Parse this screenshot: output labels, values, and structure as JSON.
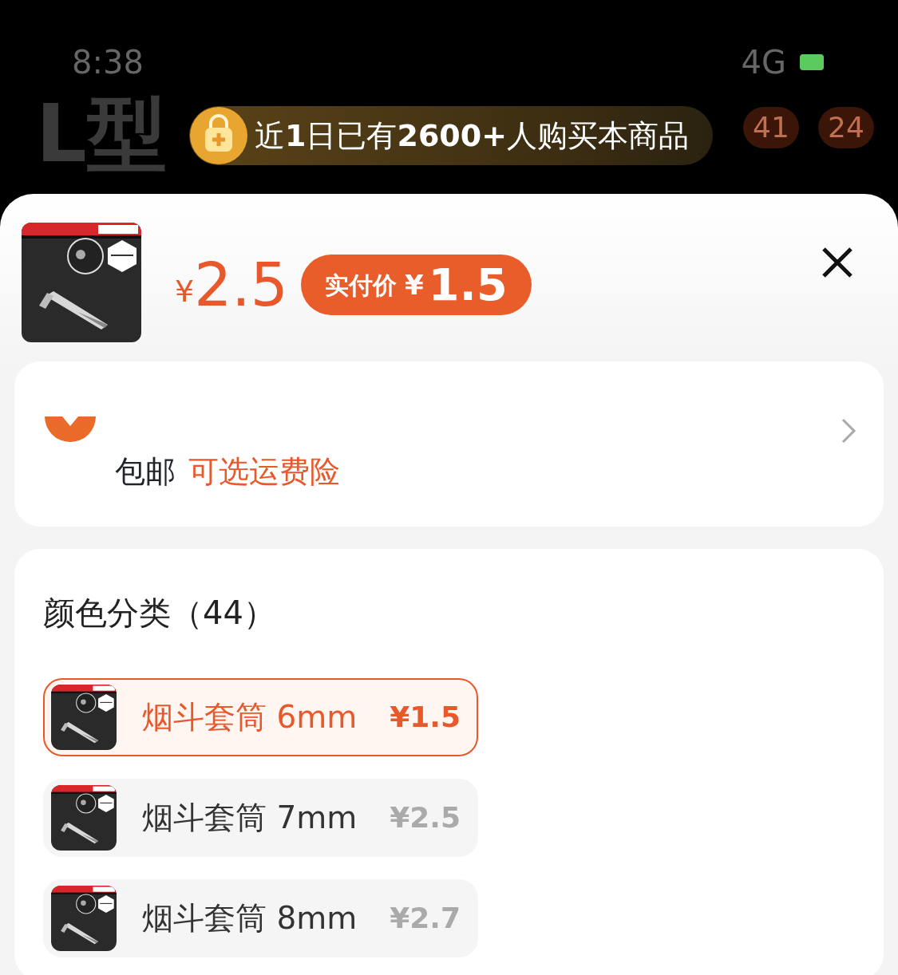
{
  "status_bar": {
    "time": "8:38",
    "network": "4G"
  },
  "background_page": {
    "title": "L型",
    "badges": [
      "41",
      "24"
    ]
  },
  "banner": {
    "text": "近**1**日已有**2600+**人购买本商品"
  },
  "product": {
    "price_symbol": "¥",
    "price": "2.5",
    "paid_label": "实付价",
    "paid_symbol": "¥",
    "paid_price": "1.5"
  },
  "shipping": {
    "label": "包邮",
    "insurance": "可选运费险"
  },
  "options": {
    "title": "颜色分类（44）",
    "items": [
      {
        "name": "烟斗套筒 6mm",
        "price": "¥1.5",
        "selected": true
      },
      {
        "name": "烟斗套筒 7mm",
        "price": "¥2.5",
        "selected": false
      },
      {
        "name": "烟斗套筒 8mm",
        "price": "¥2.7",
        "selected": false
      }
    ]
  }
}
